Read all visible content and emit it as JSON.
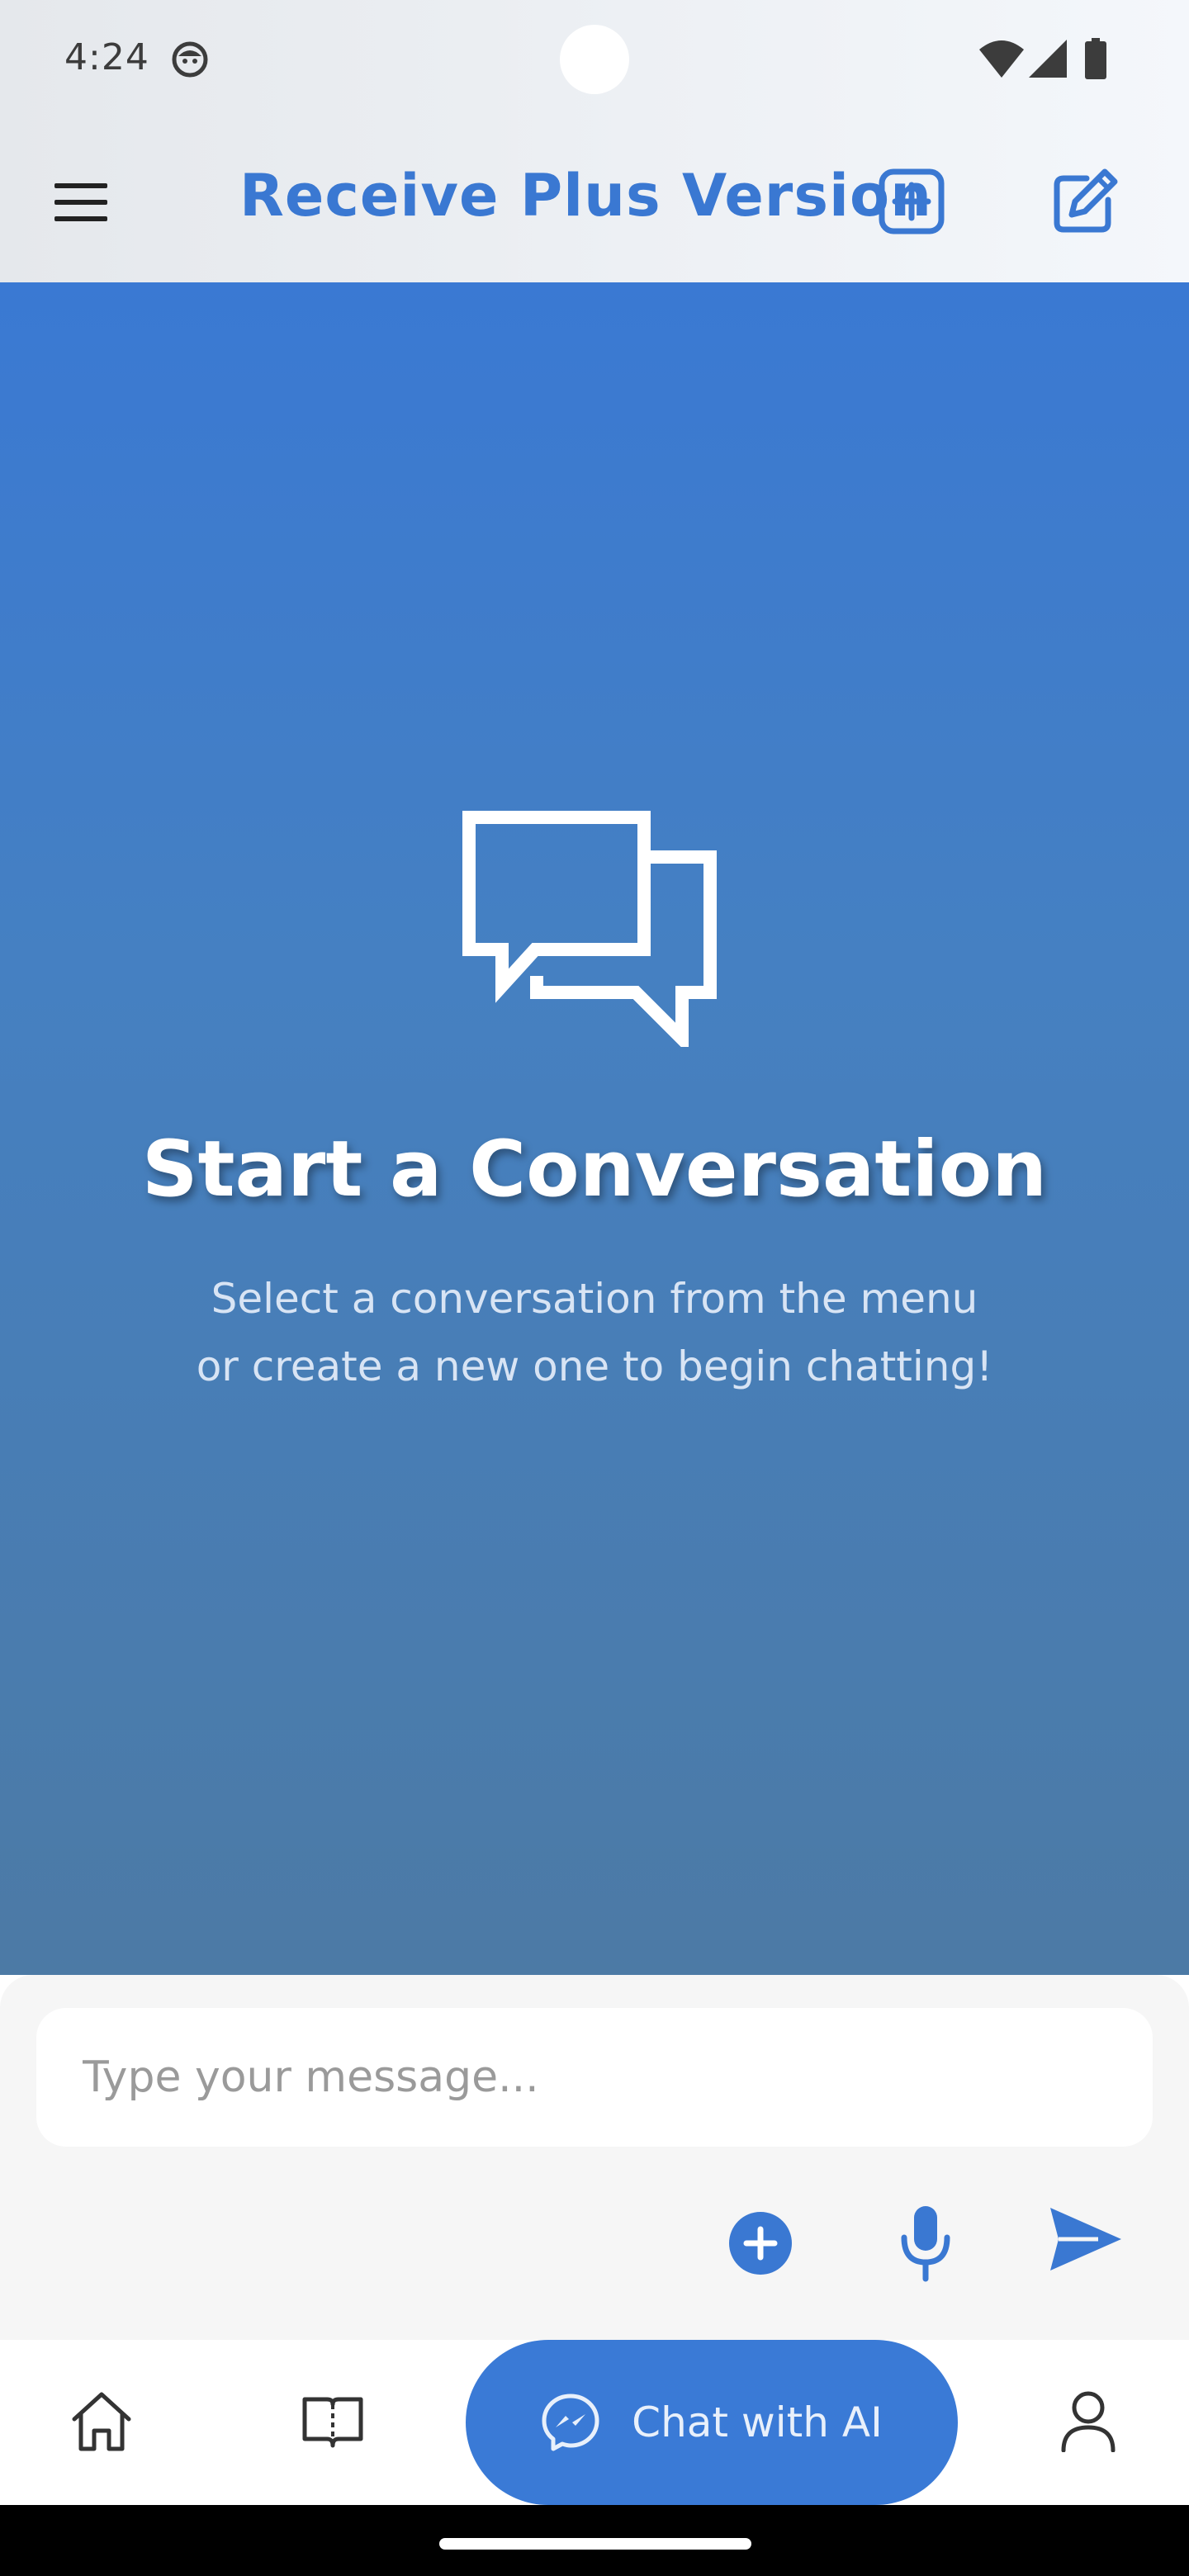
{
  "status_bar": {
    "time": "4:24"
  },
  "header": {
    "title": "Receive Plus Version"
  },
  "empty_state": {
    "title": "Start a Conversation",
    "subtitle_line1": "Select a conversation from the menu",
    "subtitle_line2": "or create a new one to begin chatting!"
  },
  "composer": {
    "placeholder": "Type your message..."
  },
  "bottom_nav": {
    "chat_label": "Chat with AI"
  },
  "icons": {
    "menu": "menu-icon",
    "plus_box": "plus-square-icon",
    "compose": "edit-icon",
    "chat_bubbles": "chat-bubbles-icon",
    "attach": "plus-circle-icon",
    "mic": "mic-icon",
    "send": "send-icon",
    "home": "home-icon",
    "book": "book-icon",
    "messenger": "messenger-icon",
    "profile": "user-icon"
  },
  "colors": {
    "accent": "#3a78d2",
    "main_gradient_top": "#3a79d3",
    "main_gradient_bottom": "#4c7aa5",
    "chat_pill": "#3a7ad6"
  }
}
